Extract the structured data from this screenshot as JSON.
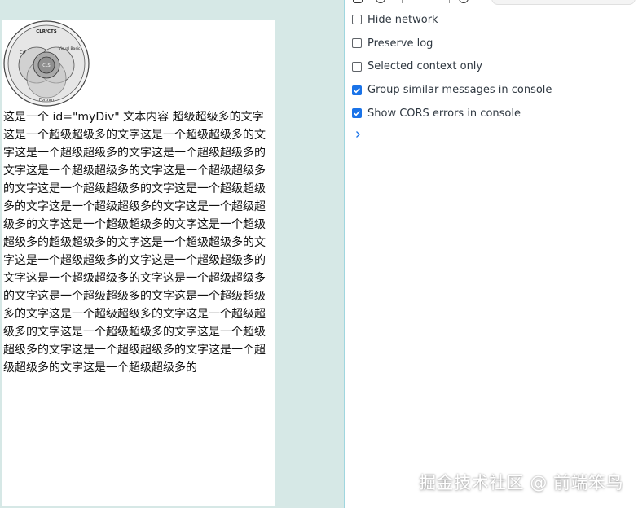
{
  "page": {
    "div_id_text": "这是一个 id=\"myDiv\" 文本内容 超级超级多的文字这是一个超级超级多的文字这是一个超级超级多的文字这是一个超级超级多的文字这是一个超级超级多的文字这是一个超级超级多的文字这是一个超级超级多的文字这是一个超级超级多的文字这是一个超级超级多的文字这是一个超级超级多的文字这是一个超级超级多的文字这是一个超级超级多的文字这是一个超级超级多的超级超级多的文字这是一个超级超级多的文字这是一个超级超级多的文字这是一个超级超级多的文字这是一个超级超级多的文字这是一个超级超级多的文字这是一个超级超级多的文字这是一个超级超级多的文字这是一个超级超级多的文字这是一个超级超级多的文字这是一个超级超级多的文字这是一个超级超级多的文字这是一个超级超级多的文字这是一个超级超级多的文字这是一个超级超级多的",
    "diagram": {
      "labels": {
        "top": "CLR/CTS",
        "left": "C#",
        "right": "Visual Basic",
        "center": "CLS",
        "bottom": "Fortran"
      }
    }
  },
  "devtools": {
    "settings": [
      {
        "label": "Hide network",
        "checked": false
      },
      {
        "label": "Preserve log",
        "checked": false
      },
      {
        "label": "Selected context only",
        "checked": false
      },
      {
        "label": "Group similar messages in console",
        "checked": true
      },
      {
        "label": "Show CORS errors in console",
        "checked": true
      }
    ],
    "prompt_icon": "chevron-right-icon"
  },
  "watermark": "掘金技术社区 @ 前端笨鸟",
  "colors": {
    "checkbox_checked": "#1a73e8",
    "divider": "#9fd6df",
    "page_bg": "#d6e8e6"
  }
}
